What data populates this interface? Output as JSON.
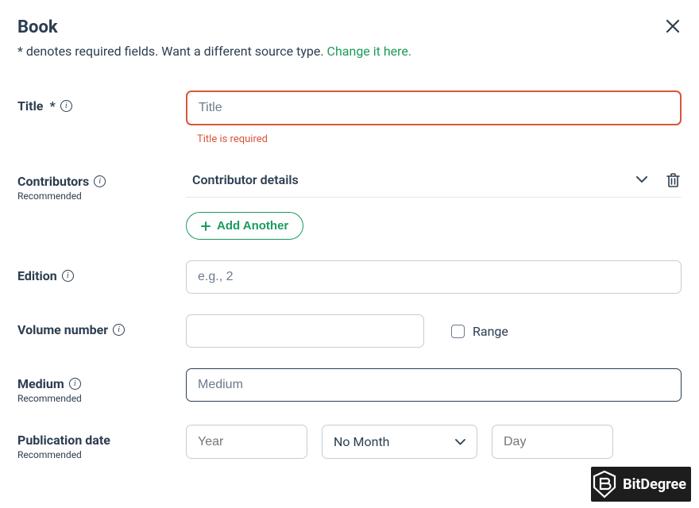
{
  "header": {
    "title": "Book",
    "subtitle_prefix": "* denotes required fields. Want a different source type. ",
    "change_link": "Change it here."
  },
  "fields": {
    "title": {
      "label": "Title",
      "required_mark": "*",
      "placeholder": "Title",
      "error": "Title is required"
    },
    "contributors": {
      "label": "Contributors",
      "recommended": "Recommended",
      "details": "Contributor details",
      "add_button": "Add Another"
    },
    "edition": {
      "label": "Edition",
      "placeholder": "e.g., 2"
    },
    "volume": {
      "label": "Volume number",
      "range_label": "Range"
    },
    "medium": {
      "label": "Medium",
      "recommended": "Recommended",
      "placeholder": "Medium"
    },
    "pubdate": {
      "label": "Publication date",
      "recommended": "Recommended",
      "year_placeholder": "Year",
      "month_selected": "No Month",
      "day_placeholder": "Day"
    }
  },
  "watermark": "BitDegree"
}
